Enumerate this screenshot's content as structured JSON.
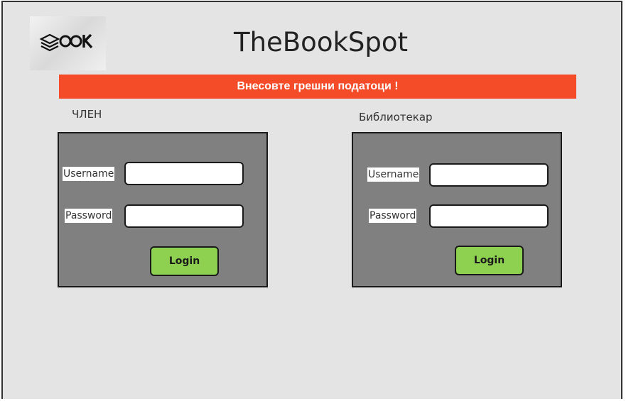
{
  "header": {
    "title": "TheBookSpot",
    "logo_icon": "book-stack-logo-icon",
    "logo_text": "BOOK"
  },
  "error": {
    "message": "Внесовте грешни податоци !"
  },
  "member": {
    "section_label": "ЧЛЕН",
    "username_label": "Username",
    "username_value": "",
    "password_label": "Password",
    "password_value": "",
    "login_label": "Login"
  },
  "librarian": {
    "section_label": "Библиотекар",
    "username_label": "Username",
    "username_value": "",
    "password_label": "Password",
    "password_value": "",
    "login_label": "Login"
  },
  "colors": {
    "background": "#e4e4e4",
    "error_banner": "#f44b28",
    "panel": "#808080",
    "login_button": "#8ed04f"
  }
}
